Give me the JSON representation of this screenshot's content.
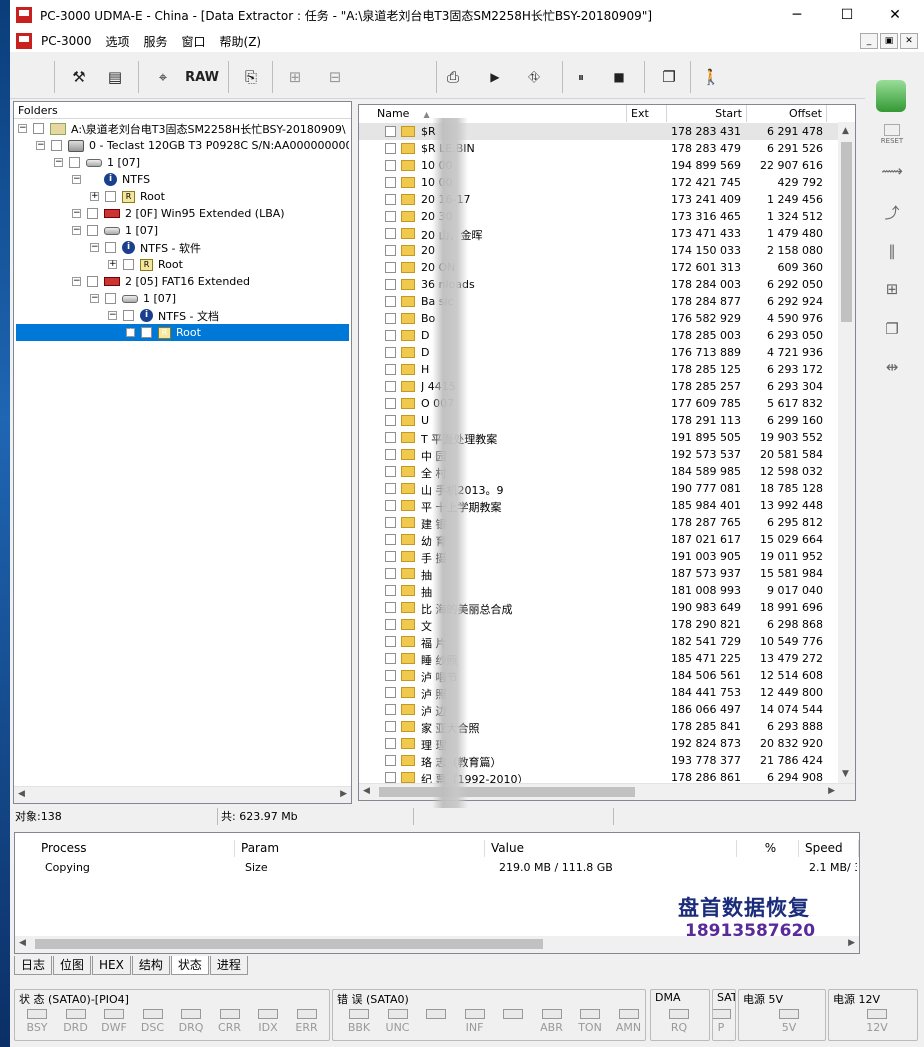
{
  "window": {
    "title": "PC-3000 UDMA-E - China - [Data Extractor : 任务 - \"A:\\泉道老刘台电T3固态SM2258H长忙BSY-20180909\"]",
    "minimize": "─",
    "maximize": "☐",
    "close": "✕"
  },
  "menu": [
    "PC-3000",
    "选项",
    "服务",
    "窗口",
    "帮助(Z)"
  ],
  "mdi": [
    "_",
    "▣",
    "✕"
  ],
  "toolbar": {
    "tools": "⚒",
    "book": "▤",
    "find": "⌖",
    "raw": "RAW",
    "export": "⎘",
    "tree1": "⊞",
    "tree2": "⊟",
    "save": "⎙",
    "play": "▶",
    "branch": "⛗",
    "pause": "⏸",
    "stop": "■",
    "copy": "❐",
    "exit": "🚶"
  },
  "right_tools": [
    "RESET"
  ],
  "folders": {
    "header": "Folders",
    "nodes": [
      {
        "label": "A:\\泉道老刘台电T3固态SM2258H长忙BSY-20180909\\"
      },
      {
        "label": "0 - Teclast 120GB T3 P0928C S/N:AA00000000000000"
      },
      {
        "label": "1 [07]"
      },
      {
        "label": "NTFS"
      },
      {
        "label": "Root"
      },
      {
        "label": "2 [0F] Win95 Extended  (LBA)"
      },
      {
        "label": "1 [07]"
      },
      {
        "label": "NTFS - 软件"
      },
      {
        "label": "Root"
      },
      {
        "label": "2 [05] FAT16 Extended"
      },
      {
        "label": "1 [07]"
      },
      {
        "label": "NTFS - 文档"
      },
      {
        "label": "Root"
      }
    ]
  },
  "files": {
    "columns": {
      "name": "Name",
      "ext": "Ext",
      "start": "Start",
      "offset": "Offset"
    },
    "rows": [
      {
        "name": "$R",
        "start": "178 283 431",
        "offset": "6 291 478"
      },
      {
        "name": "$R     LE.BIN",
        "start": "178 283 479",
        "offset": "6 291 526"
      },
      {
        "name": "10      00",
        "start": "194 899 569",
        "offset": "22 907 616"
      },
      {
        "name": "10      00",
        "start": "172 421 745",
        "offset": "429 792"
      },
      {
        "name": "20      16-17",
        "start": "173 241 409",
        "offset": "1 249 456"
      },
      {
        "name": "20      30",
        "start": "173 316 465",
        "offset": "1 324 512"
      },
      {
        "name": "20      山、金晖",
        "start": "173 471 433",
        "offset": "1 479 480"
      },
      {
        "name": "20",
        "start": "174 150 033",
        "offset": "2 158 080"
      },
      {
        "name": "20      ON",
        "start": "172 601 313",
        "offset": "609 360"
      },
      {
        "name": "36      nloads",
        "start": "178 284 003",
        "offset": "6 292 050"
      },
      {
        "name": "Ba      sic",
        "start": "178 284 877",
        "offset": "6 292 924"
      },
      {
        "name": "Bo",
        "start": "176 582 929",
        "offset": "4 590 976"
      },
      {
        "name": "D",
        "start": "178 285 003",
        "offset": "6 293 050"
      },
      {
        "name": "D",
        "start": "176 713 889",
        "offset": "4 721 936"
      },
      {
        "name": "H",
        "start": "178 285 125",
        "offset": "6 293 172"
      },
      {
        "name": "J      4415",
        "start": "178 285 257",
        "offset": "6 293 304"
      },
      {
        "name": "O      007",
        "start": "177 609 785",
        "offset": "5 617 832"
      },
      {
        "name": "U",
        "start": "178 291 113",
        "offset": "6 299 160"
      },
      {
        "name": "T      平面处理教案",
        "start": "191 895 505",
        "offset": "19 903 552"
      },
      {
        "name": "中      园",
        "start": "192 573 537",
        "offset": "20 581 584"
      },
      {
        "name": "全      村",
        "start": "184 589 985",
        "offset": "12 598 032"
      },
      {
        "name": "山      手机2013。9",
        "start": "190 777 081",
        "offset": "18 785 128"
      },
      {
        "name": "平      十上学期教案",
        "start": "185 984 401",
        "offset": "13 992 448"
      },
      {
        "name": "建      银",
        "start": "178 287 765",
        "offset": "6 295 812"
      },
      {
        "name": "幼      育",
        "start": "187 021 617",
        "offset": "15 029 664"
      },
      {
        "name": "手      摄",
        "start": "191 003 905",
        "offset": "19 011 952"
      },
      {
        "name": "抽",
        "start": "187 573 937",
        "offset": "15 581 984"
      },
      {
        "name": "抽",
        "start": "181 008 993",
        "offset": "9 017 040"
      },
      {
        "name": "比      海的美丽总合成",
        "start": "190 983 649",
        "offset": "18 991 696"
      },
      {
        "name": "文",
        "start": "178 290 821",
        "offset": "6 298 868"
      },
      {
        "name": "福      片",
        "start": "182 541 729",
        "offset": "10 549 776"
      },
      {
        "name": "睡      纱照",
        "start": "185 471 225",
        "offset": "13 479 272"
      },
      {
        "name": "泸      唱节",
        "start": "184 506 561",
        "offset": "12 514 608"
      },
      {
        "name": "泸      照",
        "start": "184 441 753",
        "offset": "12 449 800"
      },
      {
        "name": "泸      边",
        "start": "186 066 497",
        "offset": "14 074 544"
      },
      {
        "name": "家      亚大合照",
        "start": "178 285 841",
        "offset": "6 293 888"
      },
      {
        "name": "理      理",
        "start": "192 824 873",
        "offset": "20 832 920"
      },
      {
        "name": "珞      志（教育篇）",
        "start": "193 778 377",
        "offset": "21 786 424"
      },
      {
        "name": "纪      票（1992-2010）",
        "start": "178 286 861",
        "offset": "6 294 908"
      }
    ]
  },
  "status": {
    "objects": "对象:138",
    "total": "共: 623.97 Mb"
  },
  "process": {
    "headers": {
      "process": "Process",
      "param": "Param",
      "value": "Value",
      "percent": "%",
      "speed": "Speed"
    },
    "row": {
      "process": "Copying",
      "param": "Size",
      "value": "219.0 MB / 111.8 GB",
      "speed": "2.1 MB/ 3"
    }
  },
  "watermark": {
    "line1": "盘首数据恢复",
    "line2": "18913587620"
  },
  "tabs": [
    "日志",
    "位图",
    "HEX",
    "结构",
    "状态",
    "进程"
  ],
  "leds": {
    "status": {
      "title": "状 态 (SATA0)-[PIO4]",
      "labels": [
        "BSY",
        "DRD",
        "DWF",
        "DSC",
        "DRQ",
        "CRR",
        "IDX",
        "ERR"
      ]
    },
    "error": {
      "title": "错 误 (SATA0)",
      "labels": [
        "BBK",
        "UNC",
        "",
        "INF",
        "",
        "ABR",
        "TON",
        "AMN"
      ]
    },
    "dma": {
      "title": "DMA",
      "labels": [
        "RQ"
      ]
    },
    "sat": {
      "title": "SAT",
      "labels": [
        "P"
      ]
    },
    "pw5": {
      "title": "电源 5V",
      "labels": [
        "5V"
      ]
    },
    "pw12": {
      "title": "电源 12V",
      "labels": [
        "12V"
      ]
    }
  }
}
